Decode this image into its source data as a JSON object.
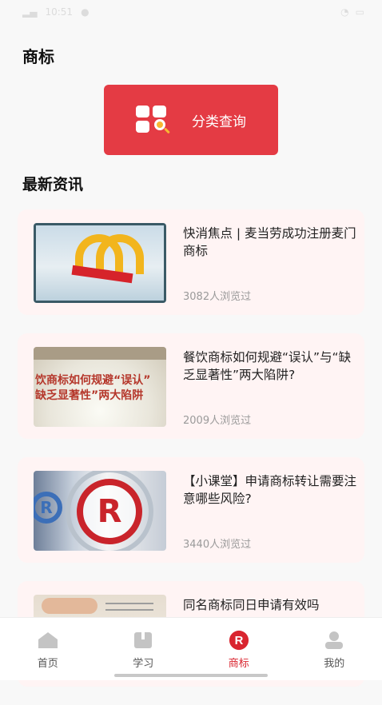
{
  "status_bar": {
    "time": "10:51"
  },
  "page": {
    "title": "商标"
  },
  "classify_button": {
    "label": "分类查询",
    "color": "#e43b44",
    "icon": "category-search-icon"
  },
  "section": {
    "latest_news_title": "最新资讯"
  },
  "news": [
    {
      "title": "快消焦点 | 麦当劳成功注册麦门商标",
      "views": "3082人浏览过",
      "thumb": "mcdonalds-arches-image"
    },
    {
      "title": "餐饮商标如何规避“误认”与“缺乏显著性”两大陷阱?",
      "views": "2009人浏览过",
      "thumb": "rice-image",
      "thumb_text_1": "饮商标如何规避“误认”",
      "thumb_text_2": "缺乏显著性”两大陷阱"
    },
    {
      "title": "【小课堂】申请商标转让需要注意哪些风险?",
      "views": "3440人浏览过",
      "thumb": "registered-mark-image",
      "thumb_big_letter": "R",
      "thumb_small_letter": "R"
    },
    {
      "title": "同名商标同日申请有效吗",
      "views": "",
      "thumb": "document-image"
    }
  ],
  "tab_bar": {
    "accent": "#d9252f",
    "tabs": [
      {
        "label": "首页",
        "icon": "home-icon",
        "active": false
      },
      {
        "label": "学习",
        "icon": "book-icon",
        "active": false
      },
      {
        "label": "商标",
        "icon": "trademark-r-icon",
        "active": true,
        "icon_letter": "R"
      },
      {
        "label": "我的",
        "icon": "profile-icon",
        "active": false
      }
    ]
  }
}
